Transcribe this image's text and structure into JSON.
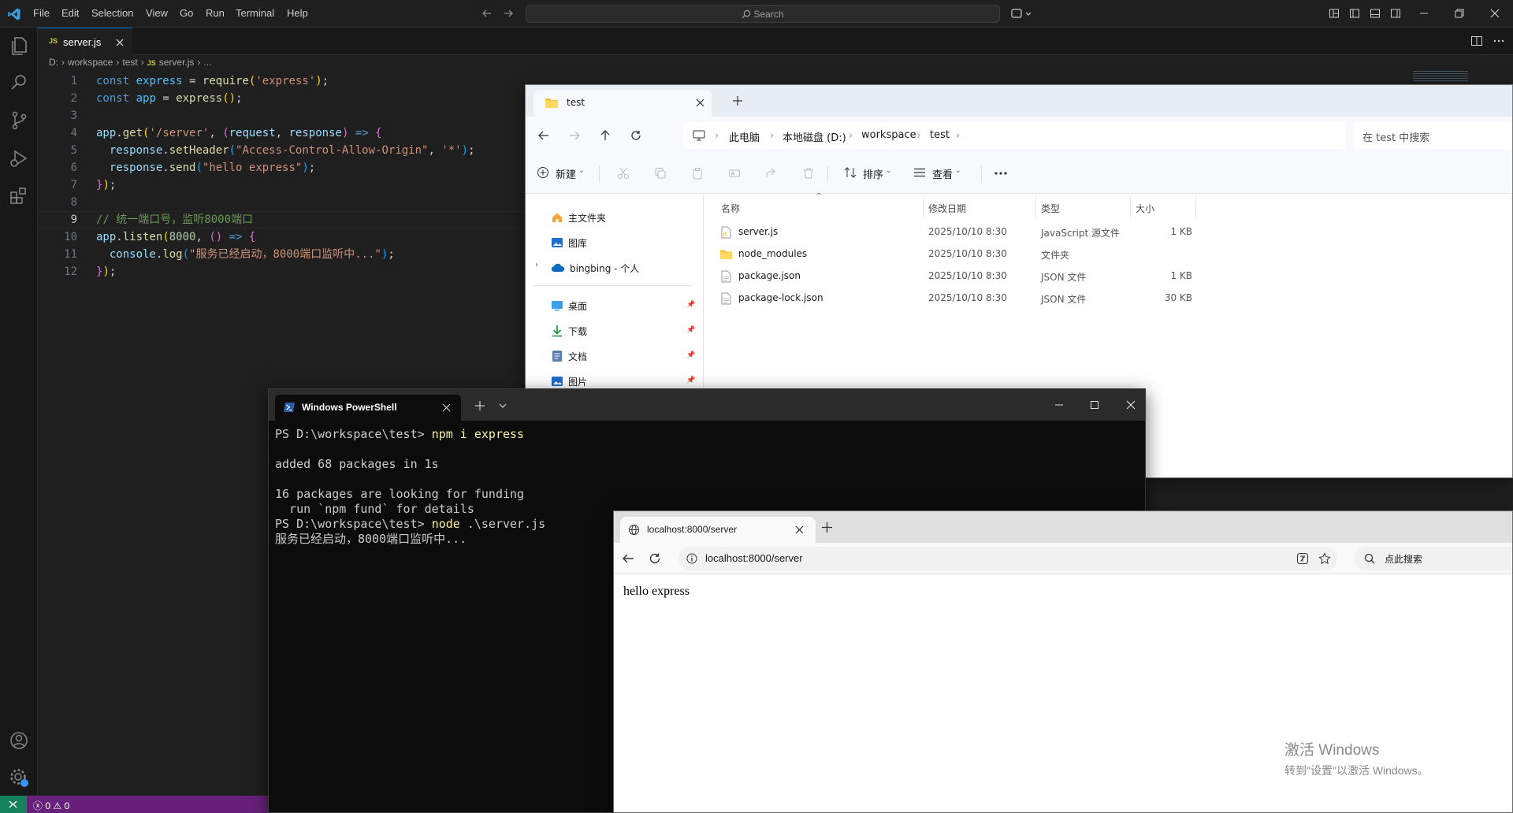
{
  "vscode": {
    "menu": [
      "File",
      "Edit",
      "Selection",
      "View",
      "Go",
      "Run",
      "Terminal",
      "Help"
    ],
    "search_placeholder": "Search",
    "tab": {
      "icon_text": "JS",
      "label": "server.js"
    },
    "breadcrumb": [
      "D:",
      "workspace",
      "test",
      "server.js",
      "..."
    ],
    "line_numbers": [
      "1",
      "2",
      "3",
      "4",
      "5",
      "6",
      "7",
      "8",
      "9",
      "10",
      "11",
      "12"
    ],
    "current_line": "9",
    "code_lines": [
      "const express = require('express');",
      "const app = express();",
      "",
      "app.get('/server', (request, response) => {",
      "  response.setHeader(\"Access-Control-Allow-Origin\", '*');",
      "  response.send(\"hello express\");",
      "});",
      "",
      "// 统一端口号，监听8000端口",
      "app.listen(8000, () => {",
      "  console.log(\"服务已经启动，8000端口监听中...\");",
      "});"
    ],
    "status": {
      "errors": "0",
      "warnings": "0"
    },
    "colors": {
      "accent": "#0078d4",
      "status_bar": "#68217a"
    }
  },
  "explorer": {
    "tab_title": "test",
    "address": [
      "此电脑",
      "本地磁盘 (D:)",
      "workspace",
      "test"
    ],
    "search_placeholder": "在 test 中搜索",
    "cmdbar": {
      "new": "新建",
      "sort": "排序",
      "view": "查看"
    },
    "sidebar": {
      "top": [
        "主文件夹",
        "图库",
        "bingbing - 个人"
      ],
      "pinned": [
        "桌面",
        "下载",
        "文档",
        "图片"
      ]
    },
    "columns": [
      "名称",
      "修改日期",
      "类型",
      "大小"
    ],
    "files": [
      {
        "name": "server.js",
        "date": "2025/10/10 8:30",
        "type": "JavaScript 源文件",
        "size": "1 KB",
        "icon": "js-file-icon"
      },
      {
        "name": "node_modules",
        "date": "2025/10/10 8:30",
        "type": "文件夹",
        "size": "",
        "icon": "folder-icon"
      },
      {
        "name": "package.json",
        "date": "2025/10/10 8:30",
        "type": "JSON 文件",
        "size": "1 KB",
        "icon": "json-file-icon"
      },
      {
        "name": "package-lock.json",
        "date": "2025/10/10 8:30",
        "type": "JSON 文件",
        "size": "30 KB",
        "icon": "json-file-icon"
      }
    ]
  },
  "terminal": {
    "title": "Windows PowerShell",
    "lines": [
      {
        "prompt": "PS D:\\workspace\\test> ",
        "cmd": "npm i express",
        "cmd_color": "#f9f1a5"
      },
      {
        "prompt": "",
        "cmd": "",
        "cmd_color": ""
      },
      {
        "prompt": "added 68 packages in 1s",
        "cmd": "",
        "cmd_color": ""
      },
      {
        "prompt": "",
        "cmd": "",
        "cmd_color": ""
      },
      {
        "prompt": "16 packages are looking for funding",
        "cmd": "",
        "cmd_color": ""
      },
      {
        "prompt": "  run `npm fund` for details",
        "cmd": "",
        "cmd_color": ""
      },
      {
        "prompt": "PS D:\\workspace\\test> ",
        "cmd": "node",
        "cmd_color": "#f9f1a5",
        "rest": " .\\server.js"
      },
      {
        "prompt": "服务已经启动，8000端口监听中...",
        "cmd": "",
        "cmd_color": ""
      }
    ]
  },
  "browser": {
    "tab_title": "localhost:8000/server",
    "url": "localhost:8000/server",
    "search_placeholder": "点此搜索",
    "body_text": "hello express"
  },
  "watermark": {
    "line1": "激活 Windows",
    "line2": "转到\"设置\"以激活 Windows。"
  }
}
